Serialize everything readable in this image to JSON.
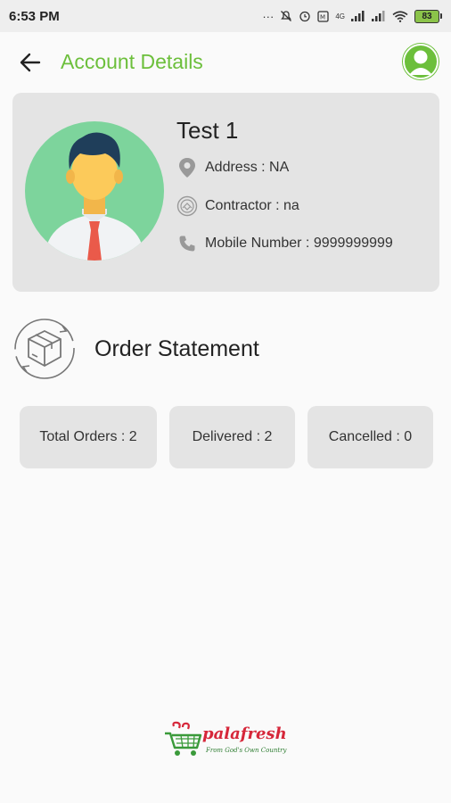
{
  "status_bar": {
    "time": "6:53 PM",
    "battery": "83",
    "network": "4G"
  },
  "header": {
    "title": "Account Details"
  },
  "profile": {
    "name": "Test 1",
    "address_text": "Address : NA",
    "contractor_text": "Contractor : na",
    "mobile_text": "Mobile Number : 9999999999"
  },
  "orders": {
    "title": "Order Statement",
    "total_text": "Total Orders : 2",
    "delivered_text": "Delivered : 2",
    "cancelled_text": "Cancelled : 0"
  },
  "brand": {
    "name": "palafresh",
    "tagline": "From God's Own Country"
  },
  "colors": {
    "accent": "#6cbf3b",
    "card": "#e4e4e4",
    "avatar_bg": "#7dd49c",
    "brand_red": "#d6273a"
  },
  "icons": [
    "back-arrow-icon",
    "user-profile-icon",
    "location-pin-icon",
    "contractor-badge-icon",
    "phone-icon",
    "box-cycle-icon",
    "cart-logo-icon"
  ]
}
